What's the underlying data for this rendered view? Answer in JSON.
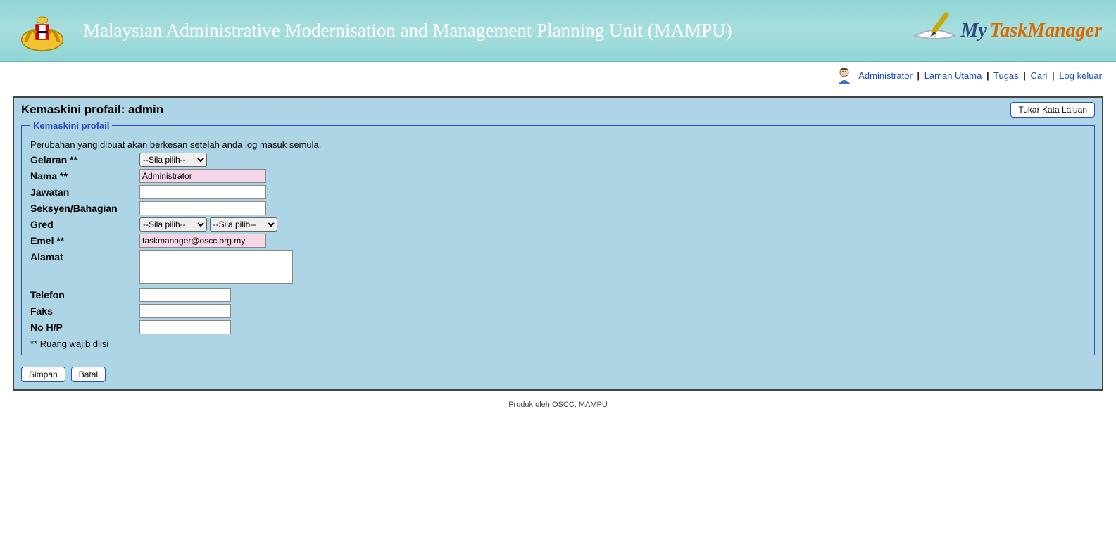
{
  "header": {
    "title": "Malaysian Administrative Modernisation and Management Planning Unit (MAMPU)",
    "app_logo_left": "My",
    "app_logo_right": "TaskManager"
  },
  "topnav": {
    "user": "Administrator",
    "links": {
      "home": "Laman Utama",
      "tasks": "Tugas",
      "search": "Cari",
      "logout": "Log keluar"
    }
  },
  "page": {
    "title": "Kemaskini profail: admin",
    "change_password_btn": "Tukar Kata Laluan"
  },
  "form": {
    "legend": "Kemaskini profail",
    "note": "Perubahan yang dibuat akan berkesan setelah anda log masuk semula.",
    "fields": {
      "gelaran": {
        "label": "Gelaran **",
        "selected": "--Sila pilih--"
      },
      "nama": {
        "label": "Nama **",
        "value": "Administrator"
      },
      "jawatan": {
        "label": "Jawatan",
        "value": ""
      },
      "seksyen": {
        "label": "Seksyen/Bahagian",
        "value": ""
      },
      "gred": {
        "label": "Gred",
        "selected1": "--Sila pilih--",
        "selected2": "--Sila pilih--"
      },
      "emel": {
        "label": "Emel **",
        "value": "taskmanager@oscc.org.my"
      },
      "alamat": {
        "label": "Alamat",
        "value": ""
      },
      "telefon": {
        "label": "Telefon",
        "value": ""
      },
      "faks": {
        "label": "Faks",
        "value": ""
      },
      "nohp": {
        "label": "No H/P",
        "value": ""
      }
    },
    "required_note": "** Ruang wajib diisi"
  },
  "buttons": {
    "save": "Simpan",
    "cancel": "Batal"
  },
  "footer": {
    "text": "Produk oleh OSCC, MAMPU"
  }
}
